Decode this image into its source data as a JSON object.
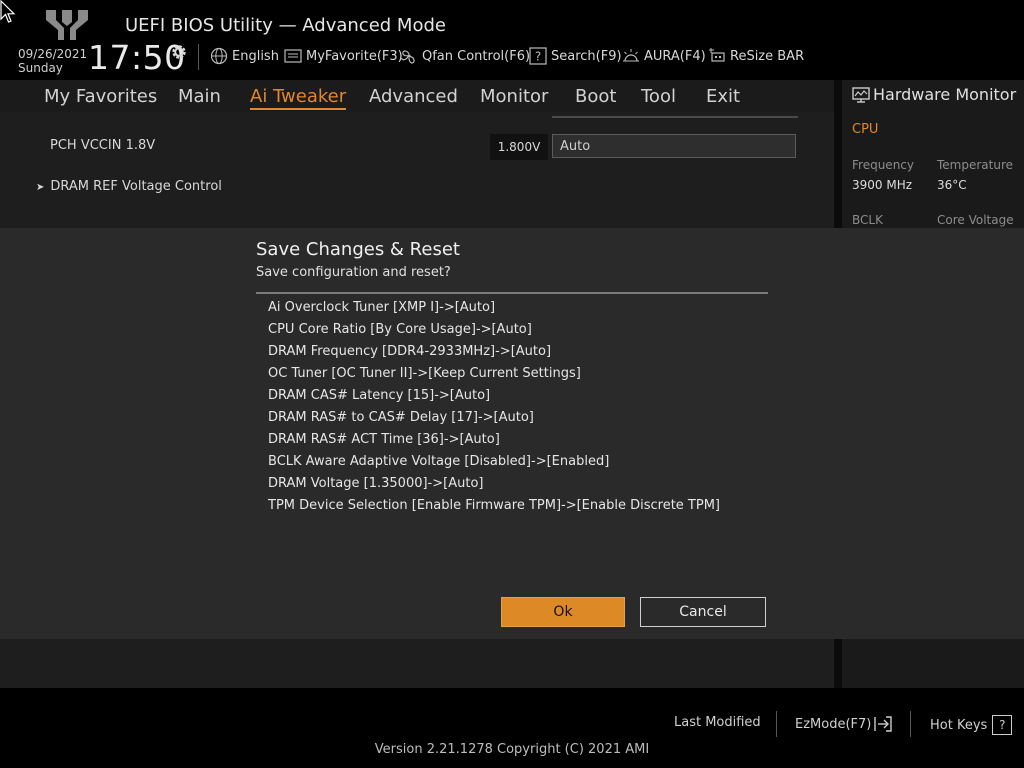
{
  "header": {
    "title": "UEFI BIOS Utility — Advanced Mode",
    "date": "09/26/2021",
    "day": "Sunday",
    "time": "17:50",
    "tools": [
      {
        "label": "English",
        "icon": "globe-icon"
      },
      {
        "label": "MyFavorite(F3)",
        "icon": "favorite-icon"
      },
      {
        "label": "Qfan Control(F6)",
        "icon": "fan-icon"
      },
      {
        "label": "Search(F9)",
        "icon": "search-help-icon"
      },
      {
        "label": "AURA(F4)",
        "icon": "aura-icon"
      },
      {
        "label": "ReSize BAR",
        "icon": "resize-bar-icon"
      }
    ]
  },
  "nav": {
    "tabs": [
      "My Favorites",
      "Main",
      "Ai Tweaker",
      "Advanced",
      "Monitor",
      "Boot",
      "Tool",
      "Exit"
    ],
    "active": "Ai Tweaker"
  },
  "content": {
    "pch_label": "PCH VCCIN 1.8V",
    "pch_value": "1.800V",
    "pch_setting": "Auto",
    "dram_ref": "DRAM REF Voltage Control"
  },
  "hw": {
    "title": "Hardware Monitor",
    "section": "CPU",
    "frequency_label": "Frequency",
    "frequency_value": "3900 MHz",
    "temperature_label": "Temperature",
    "temperature_value": "36°C",
    "bclk_label": "BCLK",
    "core_voltage_label": "Core Voltage"
  },
  "modal": {
    "title": "Save Changes & Reset",
    "subtitle": "Save configuration and reset?",
    "changes": [
      "Ai Overclock Tuner [XMP I]->[Auto]",
      "CPU Core Ratio [By Core Usage]->[Auto]",
      "DRAM Frequency [DDR4-2933MHz]->[Auto]",
      "OC Tuner [OC Tuner II]->[Keep Current Settings]",
      "DRAM CAS# Latency [15]->[Auto]",
      "DRAM RAS# to CAS# Delay [17]->[Auto]",
      "DRAM RAS# ACT Time [36]->[Auto]",
      "BCLK Aware Adaptive Voltage [Disabled]->[Enabled]",
      "DRAM Voltage [1.35000]->[Auto]",
      "TPM Device Selection [Enable Firmware TPM]->[Enable Discrete TPM]"
    ],
    "ok_label": "Ok",
    "cancel_label": "Cancel"
  },
  "footer": {
    "last_modified": "Last Modified",
    "ezmode": "EzMode(F7)",
    "hotkeys": "Hot Keys",
    "hotkeys_key": "?",
    "version": "Version 2.21.1278 Copyright (C) 2021 AMI"
  },
  "colors": {
    "accent": "#e0872b",
    "ok_button": "#dd8a26",
    "modal_bg": "#2a2a2a"
  }
}
